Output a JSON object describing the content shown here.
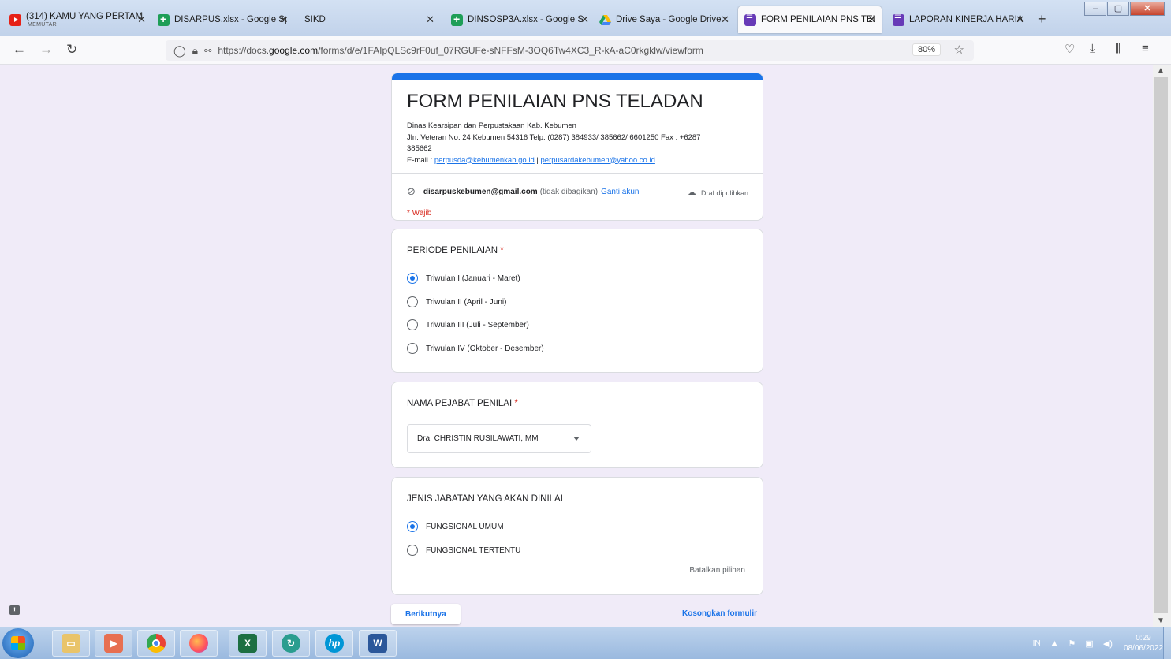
{
  "browser": {
    "tabs": [
      {
        "label": "(314) KAMU YANG PERTAM",
        "sub": "MEMUTAR",
        "icon": "youtube-icon"
      },
      {
        "label": "DISARPUS.xlsx - Google Spr",
        "icon": "sheets-icon"
      },
      {
        "label": "SIKD",
        "icon": ""
      },
      {
        "label": "DINSOSP3A.xlsx - Google S",
        "icon": "sheets-icon"
      },
      {
        "label": "Drive Saya - Google Drive",
        "icon": "drive-icon"
      },
      {
        "label": "FORM PENILAIAN PNS TEL",
        "icon": "forms-icon"
      },
      {
        "label": "LAPORAN KINERJA HARIA",
        "icon": "forms-icon"
      }
    ],
    "url_prefix": "https://docs.",
    "url_domain": "google.com",
    "url_suffix": "/forms/d/e/1FAIpQLSc9rF0uf_07RGUFe-sNFFsM-3OQ6Tw4XC3_R-kA-aC0rkgklw/viewform",
    "zoom": "80%"
  },
  "form": {
    "title": "FORM PENILAIAN PNS TELADAN",
    "desc_line1": "Dinas Kearsipan dan Perpustakaan Kab. Kebumen",
    "desc_line2": "Jln. Veteran No. 24 Kebumen 54316 Telp. (0287) 384933/ 385662/ 6601250    Fax : +6287",
    "desc_line3": "385662",
    "email_label": "E-mail : ",
    "email1": "perpusda@kebumenkab.go.id",
    "email_sep": " | ",
    "email2": "perpusardakebumen@yahoo.co.id",
    "account": "disarpuskebumen@gmail.com",
    "not_shared": "(tidak dibagikan)",
    "switch_account": "Ganti akun",
    "draft_status": "Draf dipulihkan",
    "required_note": "* Wajib",
    "q1": {
      "title": "PERIODE PENILAIAN",
      "required": "*",
      "options": [
        "Triwulan I (Januari - Maret)",
        "Triwulan II (April - Juni)",
        "Triwulan III (Juli - September)",
        "Triwulan IV (Oktober - Desember)"
      ],
      "selected": 0
    },
    "q2": {
      "title": "NAMA PEJABAT PENILAI",
      "required": "*",
      "value": "Dra. CHRISTIN RUSILAWATI, MM"
    },
    "q3": {
      "title": "JENIS JABATAN YANG AKAN DINILAI",
      "options": [
        "FUNGSIONAL UMUM",
        "FUNGSIONAL TERTENTU"
      ],
      "selected": 0,
      "clear": "Batalkan pilihan"
    },
    "next_button": "Berikutnya",
    "clear_form": "Kosongkan formulir"
  },
  "taskbar": {
    "lang": "IN",
    "time": "0:29",
    "date": "08/06/2022"
  },
  "colors": {
    "accent": "#1a73e8",
    "background": "#f0ebf8",
    "required": "#d93025"
  }
}
